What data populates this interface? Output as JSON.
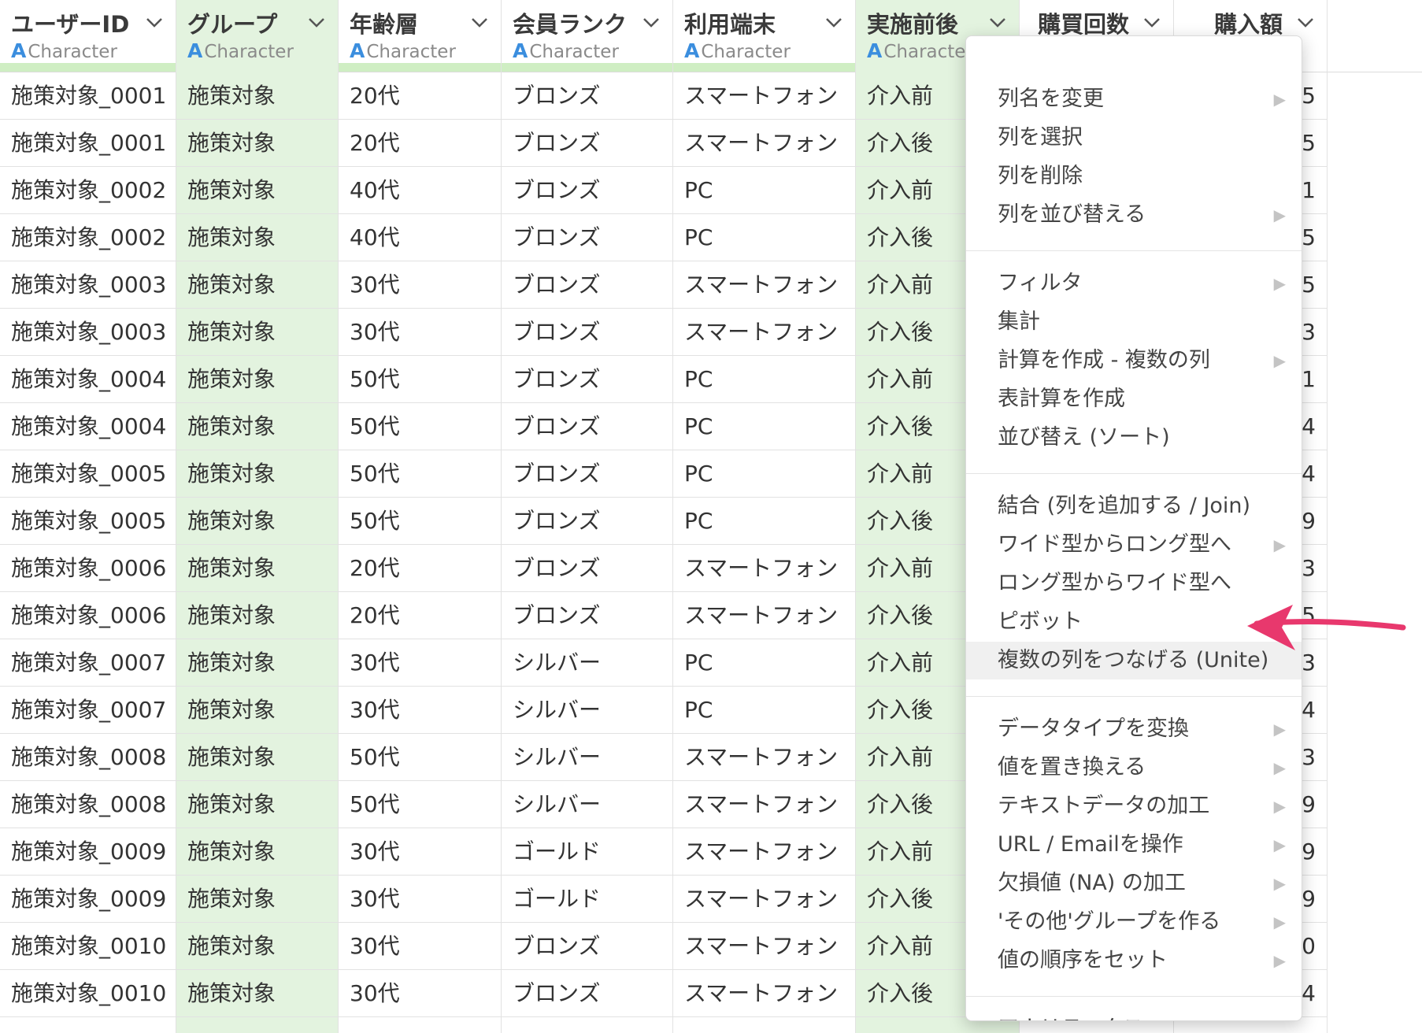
{
  "accent_color": "#3b8ede",
  "selected_col_color": "#e3f3df",
  "arrow_color": "#e8386d",
  "columns": [
    {
      "name": "ユーザーID",
      "type": "Character",
      "type_icon": "A",
      "cells": [
        "施策対象_0001",
        "施策対象_0001",
        "施策対象_0002",
        "施策対象_0002",
        "施策対象_0003",
        "施策対象_0003",
        "施策対象_0004",
        "施策対象_0004",
        "施策対象_0005",
        "施策対象_0005",
        "施策対象_0006",
        "施策対象_0006",
        "施策対象_0007",
        "施策対象_0007",
        "施策対象_0008",
        "施策対象_0008",
        "施策対象_0009",
        "施策対象_0009",
        "施策対象_0010",
        "施策対象_0010"
      ]
    },
    {
      "name": "グループ",
      "type": "Character",
      "type_icon": "A",
      "cells": [
        "施策対象",
        "施策対象",
        "施策対象",
        "施策対象",
        "施策対象",
        "施策対象",
        "施策対象",
        "施策対象",
        "施策対象",
        "施策対象",
        "施策対象",
        "施策対象",
        "施策対象",
        "施策対象",
        "施策対象",
        "施策対象",
        "施策対象",
        "施策対象",
        "施策対象",
        "施策対象"
      ]
    },
    {
      "name": "年齢層",
      "type": "Character",
      "type_icon": "A",
      "cells": [
        "20代",
        "20代",
        "40代",
        "40代",
        "30代",
        "30代",
        "50代",
        "50代",
        "50代",
        "50代",
        "20代",
        "20代",
        "30代",
        "30代",
        "50代",
        "50代",
        "30代",
        "30代",
        "30代",
        "30代"
      ]
    },
    {
      "name": "会員ランク",
      "type": "Character",
      "type_icon": "A",
      "cells": [
        "ブロンズ",
        "ブロンズ",
        "ブロンズ",
        "ブロンズ",
        "ブロンズ",
        "ブロンズ",
        "ブロンズ",
        "ブロンズ",
        "ブロンズ",
        "ブロンズ",
        "ブロンズ",
        "ブロンズ",
        "シルバー",
        "シルバー",
        "シルバー",
        "シルバー",
        "ゴールド",
        "ゴールド",
        "ブロンズ",
        "ブロンズ"
      ]
    },
    {
      "name": "利用端末",
      "type": "Character",
      "type_icon": "A",
      "cells": [
        "スマートフォン",
        "スマートフォン",
        "PC",
        "PC",
        "スマートフォン",
        "スマートフォン",
        "PC",
        "PC",
        "PC",
        "PC",
        "スマートフォン",
        "スマートフォン",
        "PC",
        "PC",
        "スマートフォン",
        "スマートフォン",
        "スマートフォン",
        "スマートフォン",
        "スマートフォン",
        "スマートフォン"
      ]
    },
    {
      "name": "実施前後",
      "type": "Characte",
      "type_icon": "A",
      "cells": [
        "介入前",
        "介入後",
        "介入前",
        "介入後",
        "介入前",
        "介入後",
        "介入前",
        "介入後",
        "介入前",
        "介入後",
        "介入前",
        "介入後",
        "介入前",
        "介入後",
        "介入前",
        "介入後",
        "介入前",
        "介入後",
        "介入前",
        "介入後"
      ]
    },
    {
      "name": "購買回数",
      "type": "",
      "type_icon": "",
      "cells": [
        "",
        "",
        "",
        "",
        "",
        "",
        "",
        "",
        "",
        "",
        "",
        "",
        "",
        "",
        "",
        "",
        "",
        "",
        "",
        ""
      ]
    },
    {
      "name": "購入額",
      "type": "",
      "type_icon": "",
      "cells": [
        "5",
        "5",
        "1",
        "5",
        "5",
        "3",
        "1",
        "4",
        "4",
        "9",
        "3",
        "5",
        "3",
        "4",
        "3",
        "9",
        "9",
        "9",
        "0",
        "4"
      ]
    }
  ],
  "menu": {
    "items": [
      {
        "label": "列名を変更",
        "submenu": true
      },
      {
        "label": "列を選択",
        "submenu": false
      },
      {
        "label": "列を削除",
        "submenu": false
      },
      {
        "label": "列を並び替える",
        "submenu": true
      },
      {
        "label": "フィルタ",
        "submenu": true
      },
      {
        "label": "集計",
        "submenu": false
      },
      {
        "label": "計算を作成 - 複数の列",
        "submenu": true
      },
      {
        "label": "表計算を作成",
        "submenu": false
      },
      {
        "label": "並び替え (ソート)",
        "submenu": false
      },
      {
        "label": "結合 (列を追加する / Join)",
        "submenu": false
      },
      {
        "label": "ワイド型からロング型へ",
        "submenu": true
      },
      {
        "label": "ロング型からワイド型へ",
        "submenu": false
      },
      {
        "label": "ピボット",
        "submenu": false
      },
      {
        "label": "複数の列をつなげる (Unite)",
        "submenu": false,
        "highlighted": true
      },
      {
        "label": "データタイプを変換",
        "submenu": true
      },
      {
        "label": "値を置き換える",
        "submenu": true
      },
      {
        "label": "テキストデータの加工",
        "submenu": true
      },
      {
        "label": "URL / Emailを操作",
        "submenu": true
      },
      {
        "label": "欠損値 (NA) の加工",
        "submenu": true
      },
      {
        "label": "'その他'グループを作る",
        "submenu": true
      },
      {
        "label": "値の順序をセット",
        "submenu": true
      },
      {
        "label": "アナリティクス",
        "submenu": true
      }
    ]
  }
}
